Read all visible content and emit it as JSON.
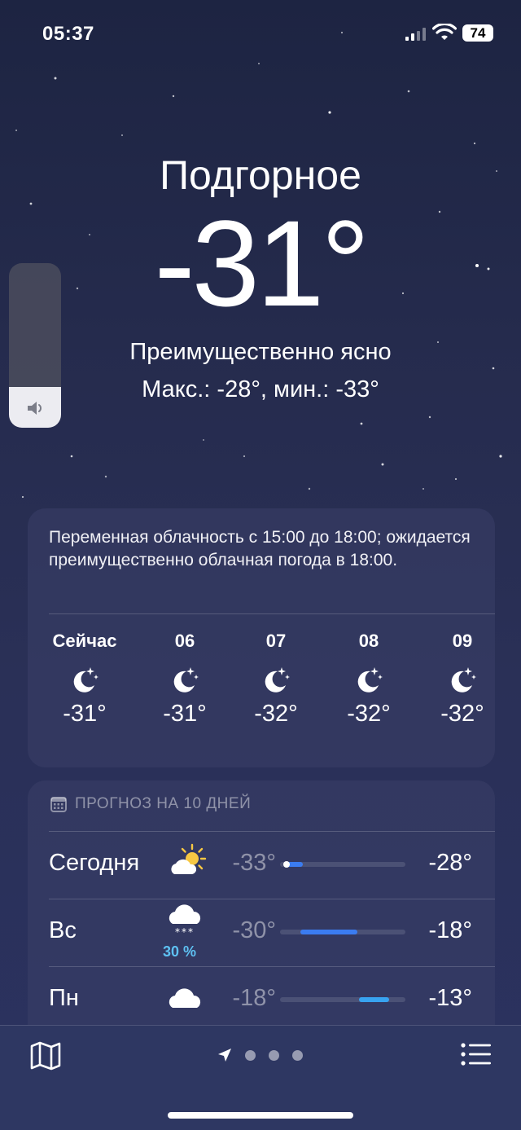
{
  "status_bar": {
    "time": "05:37",
    "battery": "74"
  },
  "location": {
    "city": "Подгорное"
  },
  "current": {
    "temperature": "-31°",
    "condition": "Преимущественно ясно",
    "high_low": "Макс.: -28°, мин.: -33°"
  },
  "hourly": {
    "summary": "Переменная облачность с 15:00 до 18:00; ожидается преимущественно облачная погода в 18:00.",
    "items": [
      {
        "label": "Сейчас",
        "icon": "moon-stars-icon",
        "temp": "-31°"
      },
      {
        "label": "06",
        "icon": "moon-stars-icon",
        "temp": "-31°"
      },
      {
        "label": "07",
        "icon": "moon-stars-icon",
        "temp": "-32°"
      },
      {
        "label": "08",
        "icon": "moon-stars-icon",
        "temp": "-32°"
      },
      {
        "label": "09",
        "icon": "moon-stars-icon",
        "temp": "-32°"
      }
    ]
  },
  "daily": {
    "header": "ПРОГНОЗ НА 10 ДНЕЙ",
    "days": [
      {
        "day": "Сегодня",
        "icon": "sun-behind-cloud-icon",
        "precip": "",
        "low": "-33°",
        "high": "-28°",
        "range_start": 0.03,
        "range_end": 0.18,
        "current_marker": 0.05
      },
      {
        "day": "Вс",
        "icon": "cloud-snow-icon",
        "precip": "30 %",
        "low": "-30°",
        "high": "-18°",
        "range_start": 0.16,
        "range_end": 0.62
      },
      {
        "day": "Пн",
        "icon": "cloud-icon",
        "precip": "",
        "low": "-18°",
        "high": "-13°",
        "range_start": 0.63,
        "range_end": 0.87
      }
    ]
  },
  "bottom_bar": {
    "page_count": 3
  },
  "colors": {
    "accent_blue": "#3b7cf0",
    "precip_blue": "#5ec1f2",
    "background": "#252b4d"
  }
}
